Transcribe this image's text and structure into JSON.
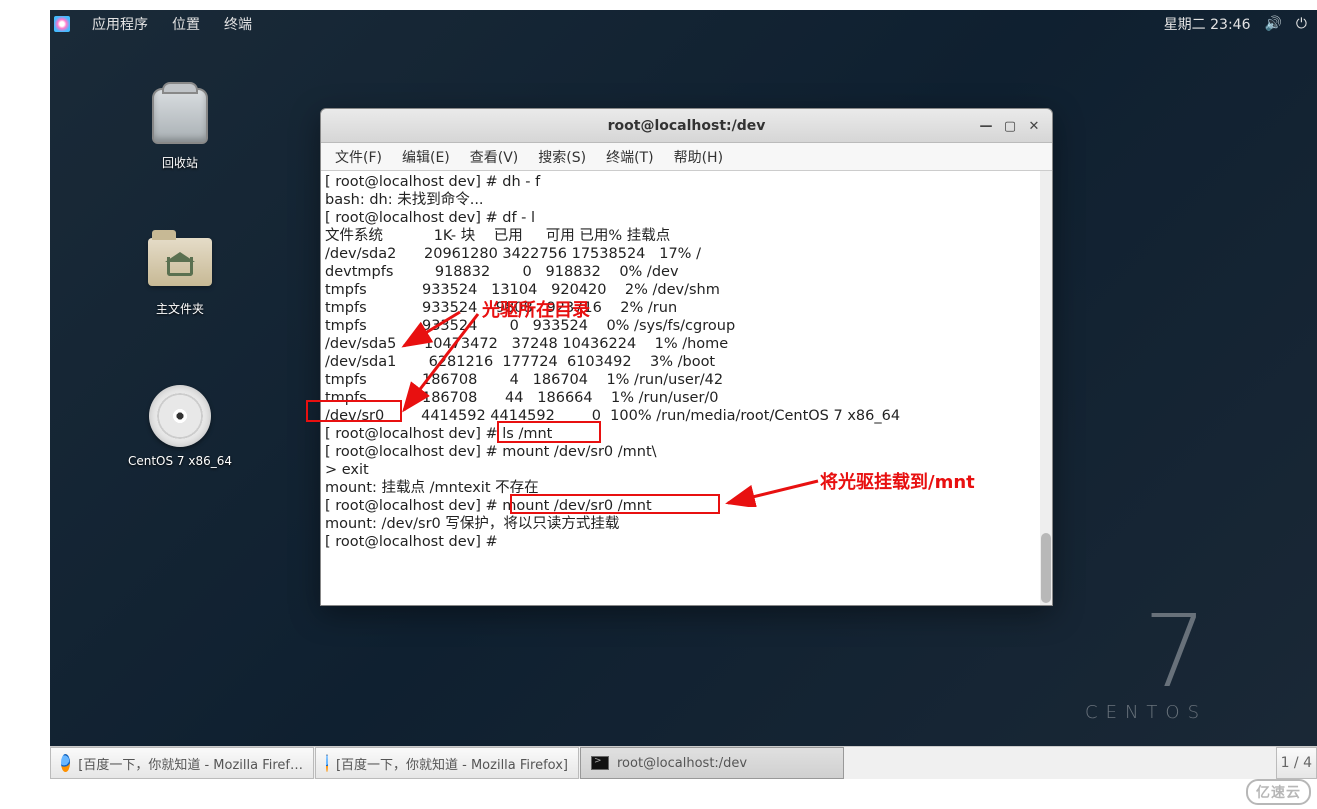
{
  "topbar": {
    "menu1": "应用程序",
    "menu2": "位置",
    "menu3": "终端",
    "datetime": "星期二 23:46"
  },
  "desktop": {
    "trash": "回收站",
    "home": "主文件夹",
    "disc": "CentOS 7 x86_64"
  },
  "centos_brand": {
    "seven": "7",
    "word": "CENTOS"
  },
  "termwin": {
    "title": "root@localhost:/dev",
    "menus": {
      "file": "文件(F)",
      "edit": "编辑(E)",
      "view": "查看(V)",
      "search": "搜索(S)",
      "terminal": "终端(T)",
      "help": "帮助(H)"
    }
  },
  "terminal_lines": [
    "[ root@localhost dev] # dh - f",
    "bash: dh: 未找到命令...",
    "[ root@localhost dev] # df - l",
    "文件系统           1K- 块    已用     可用 已用% 挂载点",
    "/dev/sda2      20961280 3422756 17538524   17% /",
    "devtmpfs         918832       0   918832    0% /dev",
    "tmpfs            933524   13104   920420    2% /dev/shm",
    "tmpfs            933524    9808   923716    2% /run",
    "tmpfs            933524       0   933524    0% /sys/fs/cgroup",
    "/dev/sda5      10473472   37248 10436224    1% /home",
    "/dev/sda1       6281216  177724  6103492    3% /boot",
    "tmpfs            186708       4   186704    1% /run/user/42",
    "tmpfs            186708      44   186664    1% /run/user/0",
    "/dev/sr0        4414592 4414592        0  100% /run/media/root/CentOS 7 x86_64",
    "[ root@localhost dev] # ls /mnt",
    "[ root@localhost dev] # mount /dev/sr0 /mnt\\",
    "> exit",
    "mount: 挂载点 /mntexit 不存在",
    "[ root@localhost dev] # mount /dev/sr0 /mnt",
    "mount: /dev/sr0 写保护，将以只读方式挂载",
    "[ root@localhost dev] # "
  ],
  "annotations": {
    "label1": "光驱所在目录",
    "label2": "将光驱挂载到/mnt"
  },
  "taskbar": {
    "t1": "[百度一下，你就知道 - Mozilla Firef…",
    "t2": "[百度一下，你就知道 - Mozilla Firefox]",
    "t3": "root@localhost:/dev",
    "pager": "1 / 4"
  },
  "watermark": "亿速云"
}
